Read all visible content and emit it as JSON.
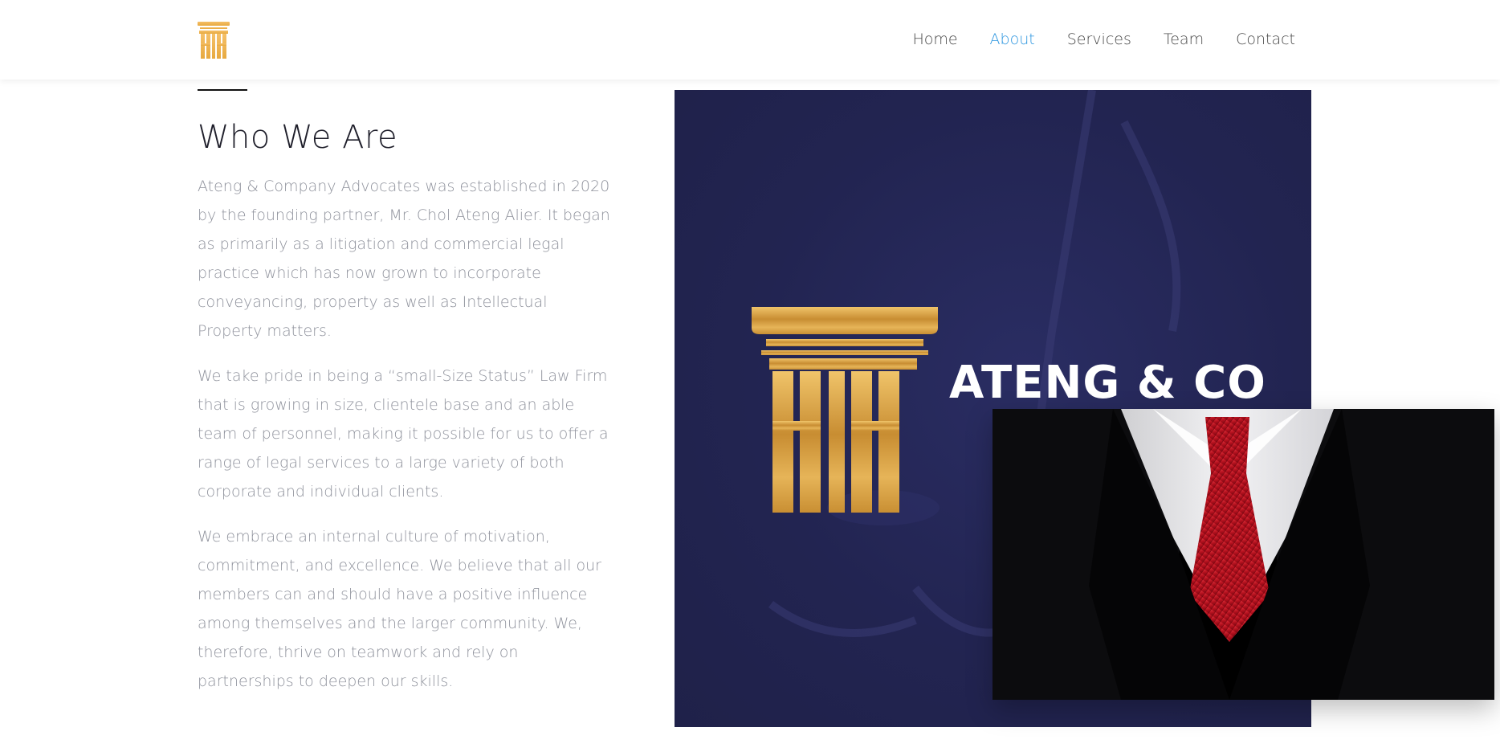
{
  "header": {
    "logo_icon": "firm-logo-icon",
    "nav": [
      {
        "label": "Home",
        "active": false
      },
      {
        "label": "About",
        "active": true
      },
      {
        "label": "Services",
        "active": false
      },
      {
        "label": "Team",
        "active": false
      },
      {
        "label": "Contact",
        "active": false
      }
    ]
  },
  "about": {
    "title": "Who We Are",
    "paragraphs": [
      "Ateng & Company Advocates was established in 2020 by the founding partner, Mr. Chol Ateng Alier. It began as primarily as a litigation and commercial legal practice which has now grown to incorporate conveyancing, property as well as Intellectual Property matters.",
      "We take pride in being a “small-Size Status” Law Firm that is growing in size, clientele base and an able team of personnel, making it possible for us to offer a range of legal services to a large variety of both corporate and individual clients.",
      "We embrace an internal culture of motivation, commitment, and excellence. We believe that all our members can and should have a positive influence among themselves and the larger community. We, therefore, thrive on teamwork and rely on partnerships to deepen our skills."
    ]
  },
  "brand_image": {
    "name": "ATENG & CO",
    "background_color": "#222451",
    "logo_color": "#d9a347"
  },
  "suit_image": {
    "icon": "suit-and-tie-image"
  },
  "colors": {
    "accent": "#2f97e0",
    "nav_text": "#4a4a4a",
    "body_text": "#8f929c",
    "gold": "#d9a347"
  }
}
